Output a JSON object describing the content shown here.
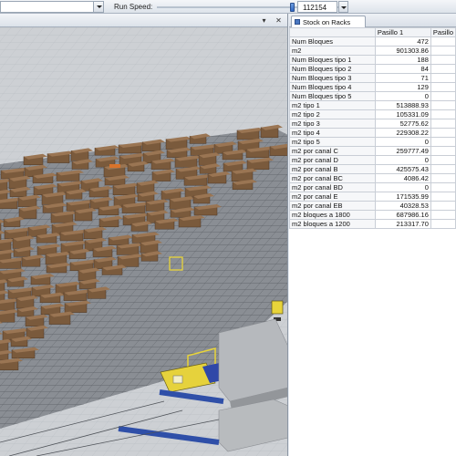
{
  "toolbar": {
    "run_speed_label": "Run Speed:",
    "run_speed_value": "112154",
    "run_speed_fraction": 0.74
  },
  "view": {
    "close_glyph": "✕",
    "icons": {
      "pin": "pin-icon",
      "close": "close-icon"
    }
  },
  "panel": {
    "tab_label": "Stock on Racks",
    "tab_icon": "table-icon",
    "columns": [
      "Pasillo 1",
      "Pasillo"
    ],
    "rows": [
      {
        "name": "Num Bloques",
        "value": "472"
      },
      {
        "name": "m2",
        "value": "901303.86"
      },
      {
        "name": "Num Bloques tipo 1",
        "value": "188"
      },
      {
        "name": "Num Bloques tipo 2",
        "value": "84"
      },
      {
        "name": "Num Bloques tipo 3",
        "value": "71"
      },
      {
        "name": "Num Bloques tipo 4",
        "value": "129"
      },
      {
        "name": "Num Bloques tipo 5",
        "value": "0"
      },
      {
        "name": "m2 tipo 1",
        "value": "513888.93"
      },
      {
        "name": "m2 tipo 2",
        "value": "105331.09"
      },
      {
        "name": "m2 tipo 3",
        "value": "52775.62"
      },
      {
        "name": "m2 tipo 4",
        "value": "229308.22"
      },
      {
        "name": "m2 tipo 5",
        "value": "0"
      },
      {
        "name": "m2 por canal C",
        "value": "259777.49"
      },
      {
        "name": "m2 por canal D",
        "value": "0"
      },
      {
        "name": "m2 por canal B",
        "value": "425575.43"
      },
      {
        "name": "m2 por canal BC",
        "value": "4086.42"
      },
      {
        "name": "m2 por canal BD",
        "value": "0"
      },
      {
        "name": "m2 por canal E",
        "value": "171535.99"
      },
      {
        "name": "m2 por canal EB",
        "value": "40328.53"
      },
      {
        "name": "m2 bloques a 1800",
        "value": "687986.16"
      },
      {
        "name": "m2 bloques a 1200",
        "value": "213317.70"
      }
    ]
  },
  "colors": {
    "block": "#7a5a3c",
    "block_top": "#9a7553",
    "rack": "#7f8389",
    "floor": "#c9ccd0",
    "forklift": "#e8d43a",
    "conveyor": "#2f4fa8"
  }
}
